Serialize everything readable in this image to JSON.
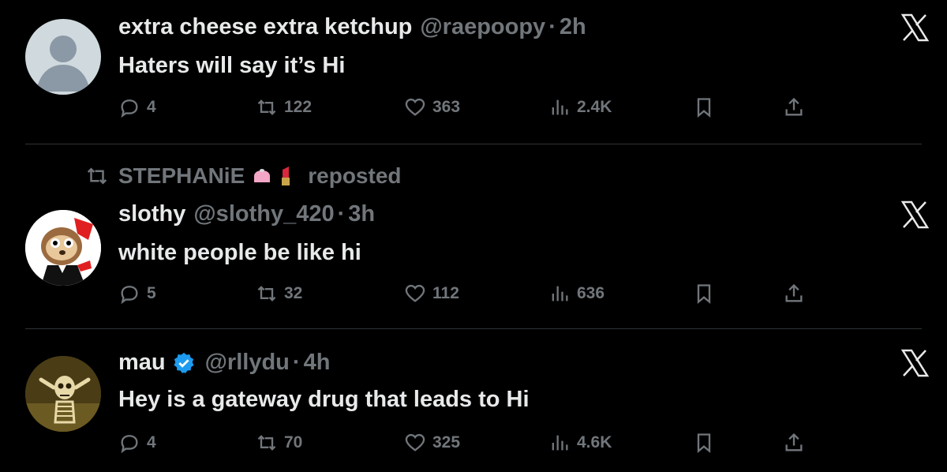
{
  "tweets": [
    {
      "display_name": "extra cheese extra ketchup",
      "handle": "@raepoopy",
      "time": "2h",
      "text": "Haters will say it’s Hi",
      "replies": "4",
      "reposts": "122",
      "likes": "363",
      "views": "2.4K",
      "avatar_icon": "default-avatar-icon"
    },
    {
      "reposted_by": "STEPHANiE",
      "reposted_label": "reposted",
      "display_name": "slothy",
      "handle": "@slothy_420",
      "time": "3h",
      "text": "white people be like hi",
      "replies": "5",
      "reposts": "32",
      "likes": "112",
      "views": "636",
      "avatar_icon": "sloth-avatar-icon"
    },
    {
      "display_name": "mau",
      "verified": true,
      "handle": "@rllydu",
      "time": "4h",
      "text": "Hey is a gateway drug that leads to Hi",
      "replies": "4",
      "reposts": "70",
      "likes": "325",
      "views": "4.6K",
      "avatar_icon": "skeleton-avatar-icon"
    }
  ],
  "separator": "·",
  "colors": {
    "background": "#000000",
    "text": "#e7e9ea",
    "muted": "#71767b",
    "divider": "#2f3336",
    "verified": "#1d9bf0"
  }
}
